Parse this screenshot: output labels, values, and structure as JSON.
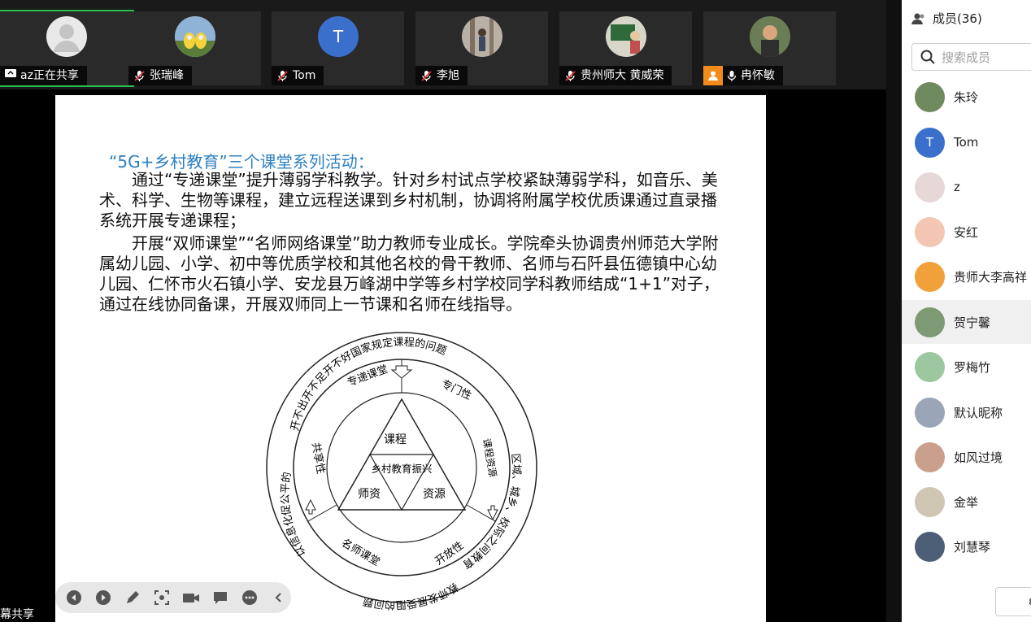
{
  "participants": [
    {
      "name": "az正在共享",
      "status": "sharing"
    },
    {
      "name": "张瑞峰",
      "status": "muted"
    },
    {
      "name": "Tom",
      "status": "muted",
      "initial": "T"
    },
    {
      "name": "李旭",
      "status": "muted"
    },
    {
      "name": "贵州师大  黄威荣",
      "status": "muted"
    },
    {
      "name": "冉怀敏",
      "status": "speaking"
    }
  ],
  "slide": {
    "title": "“5G+乡村教育”三个课堂系列活动：",
    "para1": "通过“专递课堂”提升薄弱学科教学。针对乡村试点学校紧缺薄弱学科，如音乐、美术、科学、生物等课程，建立远程送课到乡村机制，协调将附属学校优质课通过直录播系统开展专递课程；",
    "para2": "开展“双师课堂”“名师网络课堂”助力教师专业成长。学院牵头协调贵州师范大学附属幼儿园、小学、初中等优质学校和其他名校的骨干教师、名师与石阡县伍德镇中心幼儿园、仁怀市火石镇小学、安龙县万峰湖中学等乡村学校同学科教师结成“1+1”对子，通过在线协同备课，开展双师同上一节课和名师在线指导。",
    "diagram": {
      "outer_top": "开不出开不足开不好国家规定课程的问题",
      "outer_right": "区域、城乡、校际之间教育质量差距的问题",
      "outer_left": "以信息化促公平的问题",
      "outer_bottom": "教师发展受阻的问题",
      "ring_top": "专递课堂",
      "ring_right": "专门性",
      "ring_right2": "课程资源",
      "ring_bottom": "名师课堂",
      "ring_bottom2": "开放性",
      "ring_left": "共享性",
      "tri_top": "课程",
      "tri_center": "乡村教育振兴",
      "tri_left": "师资",
      "tri_right": "资源"
    }
  },
  "share_caption": "幕共享",
  "members_panel": {
    "title": "成员(36)",
    "search_placeholder": "搜索成员",
    "members": [
      {
        "name": "朱玲"
      },
      {
        "name": "Tom",
        "initial": "T"
      },
      {
        "name": "z"
      },
      {
        "name": "安红"
      },
      {
        "name": "贵师大李高祥"
      },
      {
        "name": "贺宁馨"
      },
      {
        "name": "罗梅竹"
      },
      {
        "name": "默认昵称"
      },
      {
        "name": "如风过境"
      },
      {
        "name": "金举"
      },
      {
        "name": "刘慧琴"
      }
    ],
    "bottom_button": "ε"
  },
  "colors": {
    "accent_green": "#2bbd4f",
    "avatar_blue": "#3a6fcb",
    "slide_title": "#2c7fc1",
    "speaking": "#f28b1a"
  }
}
